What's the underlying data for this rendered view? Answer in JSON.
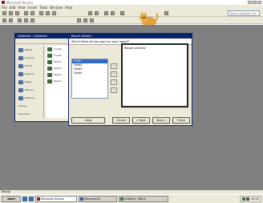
{
  "app": {
    "title": "Microsoft Access",
    "menu": [
      "File",
      "Edit",
      "View",
      "Insert",
      "Tools",
      "Window",
      "Help"
    ],
    "help_placeholder": "Type a question for help"
  },
  "db_window": {
    "title": "Database : Database",
    "objects": [
      "Tables",
      "Queries",
      "Forms",
      "Reports",
      "Pages",
      "Macros",
      "Modules",
      "Groups",
      "Favorites"
    ],
    "items": [
      "Create",
      "Create",
      "Table1",
      "Table2",
      "Table3",
      "Table4"
    ]
  },
  "wizard": {
    "title": "Report Wizard",
    "subhead": "Which fields do you want on your report?",
    "available": [
      "Field1",
      "Field2",
      "Field3",
      "Field4"
    ],
    "selected_index": 0,
    "preview_text": "Report preview",
    "buttons": {
      "cancel": "Cancel",
      "back": "< Back",
      "next": "Next >",
      "finish": "Finish",
      "help": "Help"
    }
  },
  "status": {
    "text": "Ready"
  },
  "taskbar": {
    "start": "start",
    "tasks": [
      "Microsoft Access",
      "Document1",
      "Untitled - Paint"
    ],
    "clock": "10:22"
  }
}
